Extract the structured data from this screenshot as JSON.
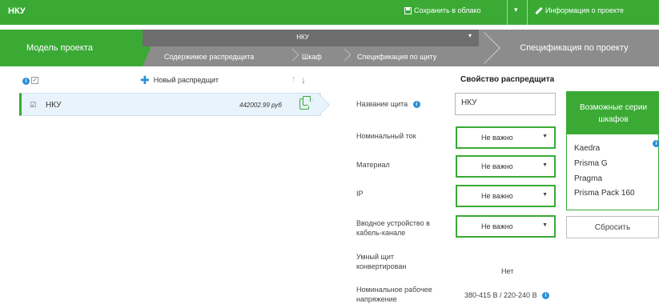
{
  "header": {
    "title": "НКУ",
    "save_label": "Сохранить в облако",
    "caret": "▾",
    "info_label": "Информация о проекте"
  },
  "steps": {
    "model": "Модель проекта",
    "group_title": "НКУ",
    "group_caret": "▾",
    "contents": "Содержимое распредщита",
    "cabinet": "Шкаф",
    "spec": "Спецификация по щиту",
    "project_spec": "Спецификация по проекту"
  },
  "list": {
    "new_label": "Новый распредщит",
    "up_arrow": "↑",
    "down_arrow": "↓",
    "rows": [
      {
        "check": "☑",
        "name": "НКУ",
        "price": "442002.99 руб"
      }
    ]
  },
  "props": {
    "title": "Свойство распредщита",
    "name_label": "Название щита",
    "name_value": "НКУ",
    "current_label": "Номинальный ток",
    "current_value": "Не важно",
    "material_label": "Материал",
    "material_value": "Не важно",
    "ip_label": "IP",
    "ip_value": "Не важно",
    "cable_label": "Вводное устройство в кабель-канале",
    "cable_value": "Не важно",
    "smart_label": "Умный щит конвертирован",
    "smart_value": "Нет",
    "voltage_label": "Номинальное рабочее напряжение",
    "voltage_value": "380-415 В / 220-240 В"
  },
  "series": {
    "title": "Возможные серии шкафов",
    "items": [
      "Kaedra",
      "Prisma G",
      "Pragma",
      "Prisma Pack 160"
    ],
    "reset_label": "Сбросить"
  },
  "colors": {
    "accent": "#3aaa35",
    "info": "#2d8fd6",
    "steps_gray": "#8c8c8c"
  }
}
